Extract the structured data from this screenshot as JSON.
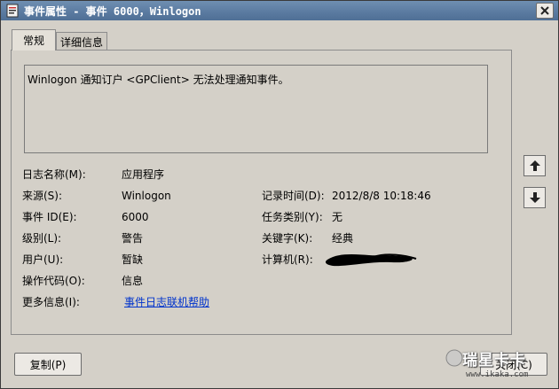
{
  "window": {
    "title": "事件属性 - 事件 6000，Winlogon",
    "close_glyph": "✕"
  },
  "tabs": [
    {
      "label": "常规",
      "selected": true
    },
    {
      "label": "详细信息",
      "selected": false
    }
  ],
  "description": "Winlogon 通知订户 <GPClient> 无法处理通知事件。",
  "fields": {
    "log_name": {
      "label": "日志名称(M):",
      "value": "应用程序"
    },
    "source": {
      "label": "来源(S):",
      "value": "Winlogon"
    },
    "event_id": {
      "label": "事件 ID(E):",
      "value": "6000"
    },
    "level": {
      "label": "级别(L):",
      "value": "警告"
    },
    "user": {
      "label": "用户(U):",
      "value": "暂缺"
    },
    "opcode": {
      "label": "操作代码(O):",
      "value": "信息"
    },
    "more_info": {
      "label": "更多信息(I):",
      "value": "事件日志联机帮助"
    },
    "logged": {
      "label": "记录时间(D):",
      "value": "2012/8/8 10:18:46"
    },
    "task_category": {
      "label": "任务类别(Y):",
      "value": "无"
    },
    "keywords": {
      "label": "关键字(K):",
      "value": "经典"
    },
    "computer": {
      "label": "计算机(R):",
      "value": ""
    }
  },
  "buttons": {
    "copy": "复制(P)",
    "close": "关闭(C)",
    "prev_icon": "arrow-up-icon",
    "next_icon": "arrow-down-icon"
  },
  "watermark": {
    "brand": "瑞星卡卡",
    "url": "www.ikaka.com"
  },
  "colors": {
    "titlebar": "#5a7aa0",
    "link": "#0033cc",
    "face": "#d4d0c8"
  }
}
